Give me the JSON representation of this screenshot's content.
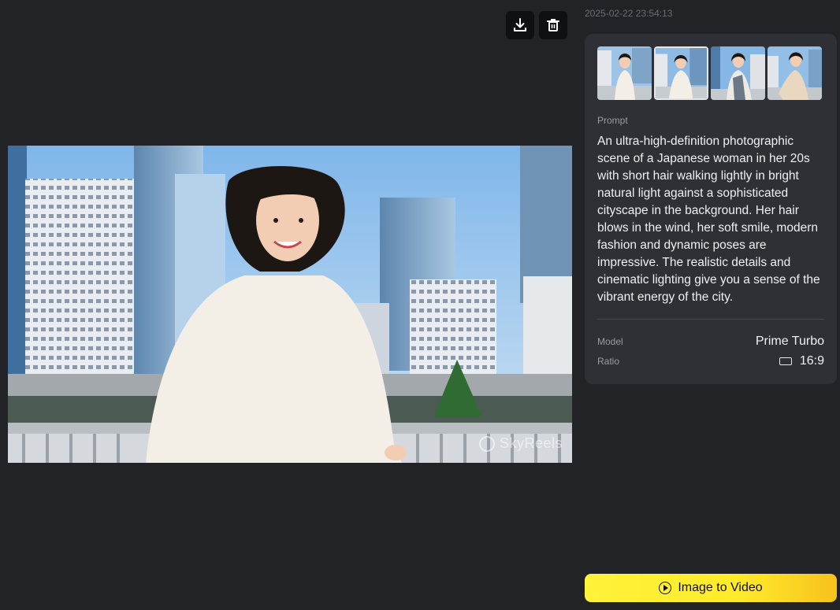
{
  "toolbar": {
    "download_icon": "download-icon",
    "delete_icon": "trash-icon"
  },
  "timestamp": "2025-02-22 23:54:13",
  "image": {
    "watermark": "SkyReels"
  },
  "panel": {
    "thumbnails": [
      {
        "selected": false
      },
      {
        "selected": true
      },
      {
        "selected": false
      },
      {
        "selected": false
      }
    ],
    "prompt_label": "Prompt",
    "prompt_text": "An ultra-high-definition photographic scene of a Japanese woman in her 20s with short hair walking lightly in bright natural light against a sophisticated cityscape in the background. Her hair blows in the wind, her soft smile, modern fashion and dynamic poses are impressive. The realistic details and cinematic lighting give you a sense of the vibrant energy of the city.",
    "model_label": "Model",
    "model_value": "Prime Turbo",
    "ratio_label": "Ratio",
    "ratio_value": "16:9"
  },
  "action": {
    "image_to_video_label": "Image to Video"
  },
  "colors": {
    "background": "#222327",
    "panel": "#2f3035",
    "accent": "#fff23a"
  }
}
